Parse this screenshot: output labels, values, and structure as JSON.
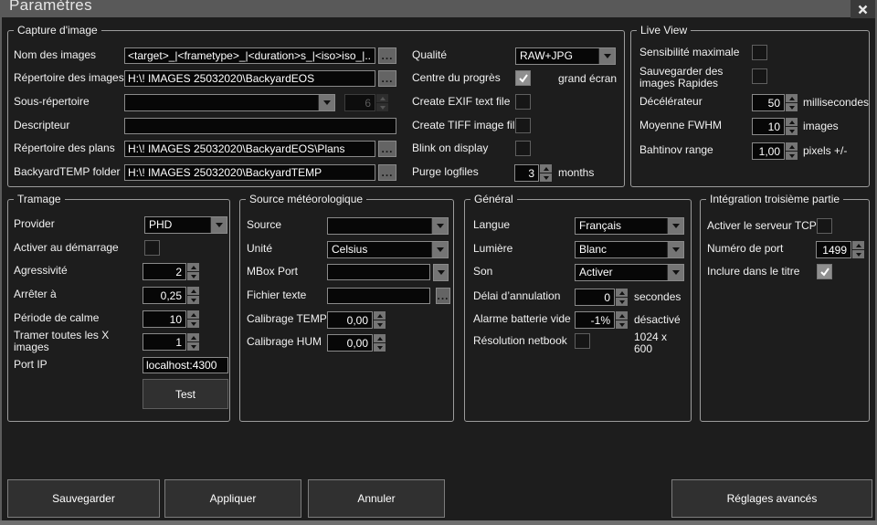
{
  "window": {
    "title": "Paramètres",
    "close_icon": "✕"
  },
  "icons": {
    "browse": "...",
    "dropdown_arrow": "▼",
    "spinner_up": "▲",
    "spinner_down": "▼",
    "checkmark": "✓"
  },
  "groups": {
    "capture": {
      "title": "Capture d'image",
      "nom": {
        "label": "Nom des images",
        "value": "<target>_|<frametype>_|<duration>s_|<iso>iso_|..."
      },
      "repertoire": {
        "label": "Répertoire des images",
        "value": "H:\\! IMAGES 25032020\\BackyardEOS"
      },
      "sous": {
        "label": "Sous-répertoire",
        "value": "",
        "spin_value": "6"
      },
      "descripteur": {
        "label": "Descripteur",
        "value": ""
      },
      "plans": {
        "label": "Répertoire des plans",
        "value": "H:\\! IMAGES 25032020\\BackyardEOS\\Plans"
      },
      "temp": {
        "label": "BackyardTEMP folder",
        "value": "H:\\! IMAGES 25032020\\BackyardTEMP"
      },
      "qualite": {
        "label": "Qualité",
        "value": "RAW+JPG"
      },
      "centre": {
        "label": "Centre du progrès",
        "checked": true,
        "suffix": "grand écran"
      },
      "exif": {
        "label": "Create EXIF text file",
        "checked": false
      },
      "tiff": {
        "label": "Create TIFF image file",
        "checked": false
      },
      "blink": {
        "label": "Blink on display",
        "checked": false
      },
      "purge": {
        "label": "Purge logfiles",
        "value": "3",
        "suffix": "months"
      }
    },
    "liveview": {
      "title": "Live View",
      "sens": {
        "label": "Sensibilité maximale",
        "checked": false
      },
      "rapides": {
        "label": "Sauvegarder des\n images Rapides",
        "checked": false
      },
      "decel": {
        "label": "Décélérateur",
        "value": "50",
        "suffix": "millisecondes"
      },
      "fwhm": {
        "label": "Moyenne FWHM",
        "value": "10",
        "suffix": "images"
      },
      "bahtinov": {
        "label": "Bahtinov range",
        "value": "1,00",
        "suffix": "pixels +/-"
      }
    },
    "tramage": {
      "title": "Tramage",
      "provider": {
        "label": "Provider",
        "value": "PHD"
      },
      "demarrage": {
        "label": "Activer au démarrage",
        "checked": false
      },
      "agressivite": {
        "label": "Agressivité",
        "value": "2"
      },
      "arreter": {
        "label": "Arrêter à",
        "value": "0,25"
      },
      "periode": {
        "label": "Période de calme",
        "value": "10"
      },
      "tramer": {
        "label": "Tramer toutes les X\nimages",
        "value": "1"
      },
      "portip": {
        "label": "Port IP",
        "value": "localhost:4300"
      },
      "test": {
        "label": "Test"
      }
    },
    "meteo": {
      "title": "Source météorologique",
      "source": {
        "label": "Source",
        "value": ""
      },
      "unite": {
        "label": "Unité",
        "value": "Celsius"
      },
      "mbox": {
        "label": "MBox Port",
        "value": ""
      },
      "fichier": {
        "label": "Fichier texte",
        "value": ""
      },
      "caltemp": {
        "label": "Calibrage TEMP",
        "value": "0,00"
      },
      "calhum": {
        "label": "Calibrage HUM",
        "value": "0,00"
      }
    },
    "general": {
      "title": "Général",
      "langue": {
        "label": "Langue",
        "value": "Français"
      },
      "lumiere": {
        "label": "Lumière",
        "value": "Blanc"
      },
      "son": {
        "label": "Son",
        "value": "Activer"
      },
      "delai": {
        "label": "Délai d’annulation",
        "value": "0",
        "suffix": "secondes"
      },
      "alarme": {
        "label": "Alarme batterie vide",
        "value": "-1%",
        "suffix": "désactivé"
      },
      "netbook": {
        "label": "Résolution netbook",
        "checked": false,
        "suffix": "1024 x\n600"
      }
    },
    "integration": {
      "title": "Intégration troisième partie",
      "tcp": {
        "label": "Activer le serveur TCP",
        "checked": false
      },
      "numport": {
        "label": "Numéro de port",
        "value": "1499"
      },
      "titre": {
        "label": "Inclure dans le titre",
        "checked": true
      }
    }
  },
  "buttons": {
    "sauvegarder": "Sauvegarder",
    "appliquer": "Appliquer",
    "annuler": "Annuler",
    "avances": "Réglages avancés"
  }
}
